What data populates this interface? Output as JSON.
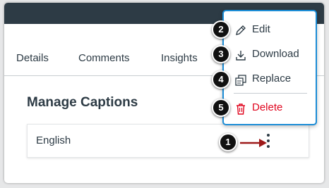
{
  "tabs": [
    {
      "label": "Details"
    },
    {
      "label": "Comments"
    },
    {
      "label": "Insights"
    }
  ],
  "captions": {
    "heading": "Manage Captions",
    "row_label": "English"
  },
  "menu": {
    "items": [
      {
        "label": "Edit",
        "icon": "pencil-icon",
        "badge": "2"
      },
      {
        "label": "Download",
        "icon": "download-icon",
        "badge": "3"
      },
      {
        "label": "Replace",
        "icon": "replace-icon",
        "badge": "4"
      },
      {
        "label": "Delete",
        "icon": "trash-icon",
        "badge": "5",
        "color": "#e0061f"
      }
    ]
  },
  "callout_options_badge": "1",
  "colors": {
    "topbar": "#2d3b45",
    "menu_border": "#1b8cd6",
    "delete": "#e0061f",
    "arrow": "#9e1a1a",
    "badge": "#111111"
  }
}
